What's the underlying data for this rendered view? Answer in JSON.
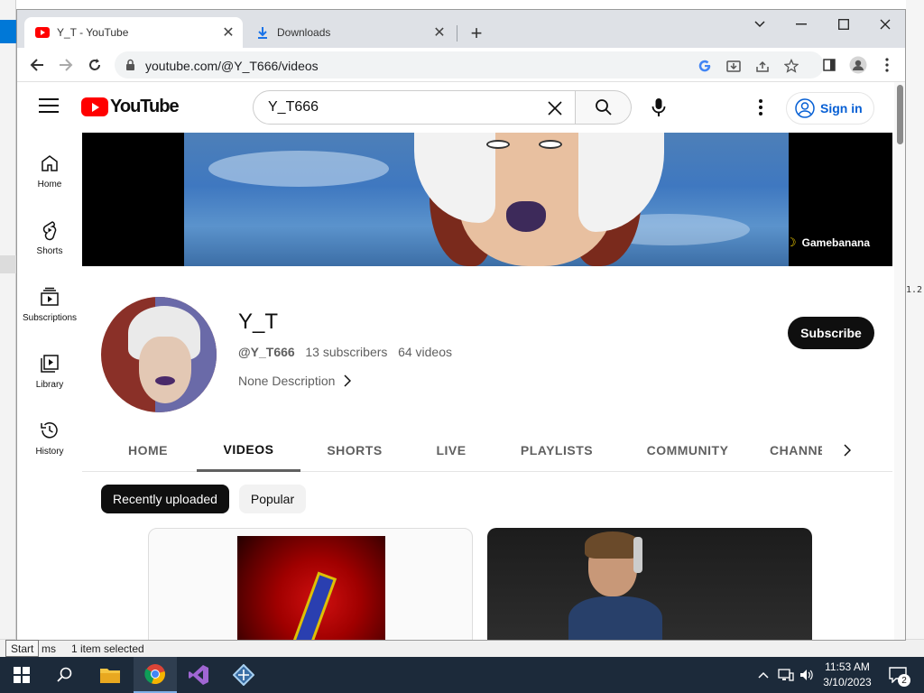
{
  "background": {
    "right_fragment": "1.2",
    "status_items": "ms",
    "status_selected": "1 item selected",
    "start_tooltip": "Start"
  },
  "browser": {
    "tabs": [
      {
        "title": "Y_T - YouTube",
        "icon": "youtube-icon",
        "active": true
      },
      {
        "title": "Downloads",
        "icon": "download-icon",
        "active": false
      }
    ],
    "url": "youtube.com/@Y_T666/videos"
  },
  "youtube": {
    "logo_text": "YouTube",
    "search_value": "Y_T666",
    "signin_label": "Sign in",
    "guide": [
      {
        "label": "Home",
        "icon": "home-icon"
      },
      {
        "label": "Shorts",
        "icon": "shorts-icon"
      },
      {
        "label": "Subscriptions",
        "icon": "subscriptions-icon"
      },
      {
        "label": "Library",
        "icon": "library-icon"
      },
      {
        "label": "History",
        "icon": "history-icon"
      }
    ],
    "banner_watermark": "Gamebanana",
    "channel": {
      "name": "Y_T",
      "handle": "@Y_T666",
      "subscribers": "13 subscribers",
      "videos": "64 videos",
      "description": "None Description",
      "subscribe_label": "Subscribe"
    },
    "tabs": [
      "HOME",
      "VIDEOS",
      "SHORTS",
      "LIVE",
      "PLAYLISTS",
      "COMMUNITY",
      "CHANNELS"
    ],
    "selected_tab": "VIDEOS",
    "chips": [
      "Recently uploaded",
      "Popular"
    ],
    "selected_chip": "Recently uploaded"
  },
  "taskbar": {
    "time": "11:53 AM",
    "date": "3/10/2023",
    "notification_count": "2",
    "apps": [
      "windows-start-icon",
      "search-icon",
      "file-explorer-icon",
      "chrome-icon",
      "visual-studio-icon",
      "network-app-icon"
    ]
  },
  "colors": {
    "youtube_red": "#ff0000",
    "signin_blue": "#065fd4",
    "taskbar": "#1c2a3a"
  }
}
